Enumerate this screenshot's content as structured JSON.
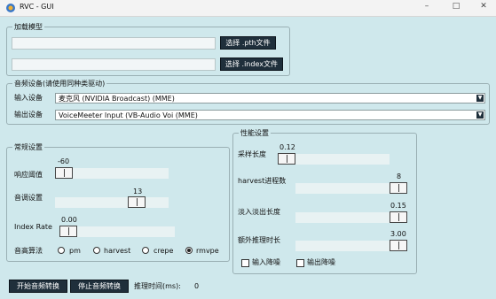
{
  "window": {
    "title": "RVC - GUI"
  },
  "model": {
    "legend": "加载模型",
    "pth_button": "选择 .pth文件",
    "index_button": "选择 .index文件",
    "pth_value": "",
    "index_value": ""
  },
  "devices": {
    "legend": "音频设备(请使用同种类驱动)",
    "input_label": "输入设备",
    "input_value": "麦克风 (NVIDIA Broadcast) (MME)",
    "output_label": "输出设备",
    "output_value": "VoiceMeeter Input (VB-Audio Voi (MME)"
  },
  "general": {
    "legend": "常规设置",
    "threshold": {
      "label": "响应阈值",
      "value": "-60",
      "level": 0.0
    },
    "pitch": {
      "label": "音调设置",
      "value": "13",
      "level": 0.5
    },
    "index_rate": {
      "label": "Index Rate",
      "value": "0.00",
      "level": 0.0
    },
    "f0_label": "音高算法",
    "f0_options": [
      "pm",
      "harvest",
      "crepe",
      "rmvpe"
    ],
    "f0_selected": "rmvpe"
  },
  "performance": {
    "legend": "性能设置",
    "sample_length": {
      "label": "采样长度",
      "value": "0.12",
      "level": 0.0
    },
    "harvest_procs": {
      "label": "harvest进程数",
      "value": "8",
      "level": 1.0
    },
    "crossfade": {
      "label": "淡入淡出长度",
      "value": "0.15",
      "level": 1.0
    },
    "extra_time": {
      "label": "额外推理时长",
      "value": "3.00",
      "level": 1.0
    },
    "input_denoise": "输入降噪",
    "output_denoise": "输出降噪"
  },
  "actions": {
    "start": "开始音频转换",
    "stop": "停止音频转换",
    "infer_time_label": "推理时间(ms):",
    "infer_time_value": "0"
  }
}
